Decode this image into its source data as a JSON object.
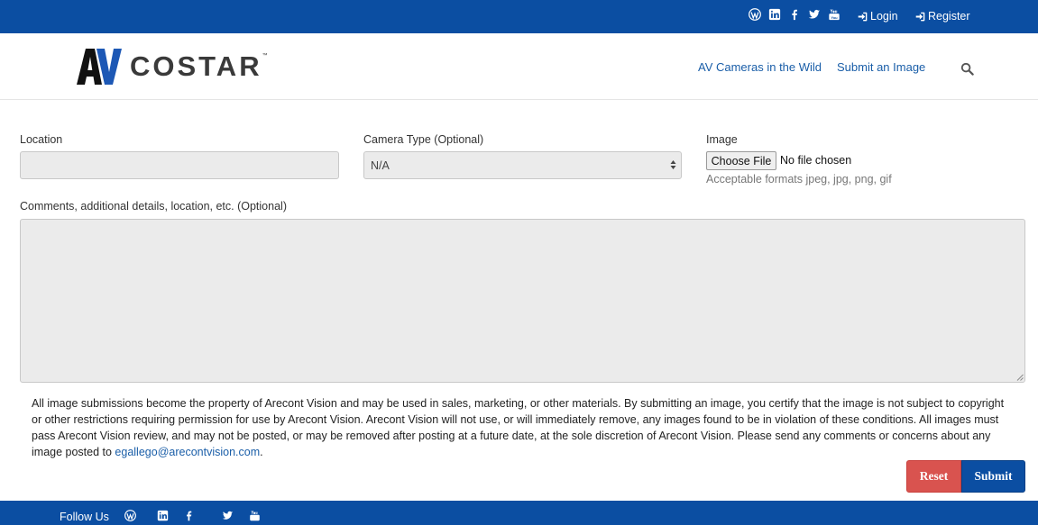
{
  "topbar": {
    "social_icons": [
      "wordpress-icon",
      "linkedin-icon",
      "facebook-icon",
      "twitter-icon",
      "youtube-icon"
    ],
    "login_label": "Login",
    "register_label": "Register"
  },
  "header": {
    "logo_mark": "AV",
    "logo_word": "COSTAR",
    "logo_tm": "™",
    "nav": [
      "AV Cameras in the Wild",
      "Submit an Image"
    ],
    "search_icon": "search-icon"
  },
  "form": {
    "location_label": "Location",
    "location_value": "",
    "camera_label": "Camera Type (Optional)",
    "camera_value": "N/A",
    "image_label": "Image",
    "file_button": "Choose File",
    "file_status": "No file chosen",
    "image_help": "Acceptable formats jpeg, jpg, png, gif",
    "comments_label": "Comments, additional details, location, etc. (Optional)",
    "comments_value": "",
    "notice_text": "All image submissions become the property of Arecont Vision and may be used in sales, marketing, or other materials. By submitting an image, you certify that the image is not subject to copyright or other restrictions requiring permission for use by Arecont Vision. Arecont Vision will not use, or will immediately remove, any images found to be in violation of these conditions. All images must pass Arecont Vision review, and may not be posted, or may be removed after posting at a future date, at the sole discretion of Arecont Vision. Please send any comments or concerns about any image posted to ",
    "notice_email": "egallego@arecontvision.com",
    "notice_end": ".",
    "reset_label": "Reset",
    "submit_label": "Submit"
  },
  "footer": {
    "follow_label": "Follow Us",
    "social_icons": [
      "wordpress-icon",
      "linkedin-icon",
      "facebook-icon",
      "twitter-icon",
      "youtube-icon"
    ]
  },
  "colors": {
    "brand_blue": "#0b4ea2",
    "link_blue": "#1a5ea8",
    "reset_red": "#d9534f",
    "field_gray": "#ebebeb"
  }
}
